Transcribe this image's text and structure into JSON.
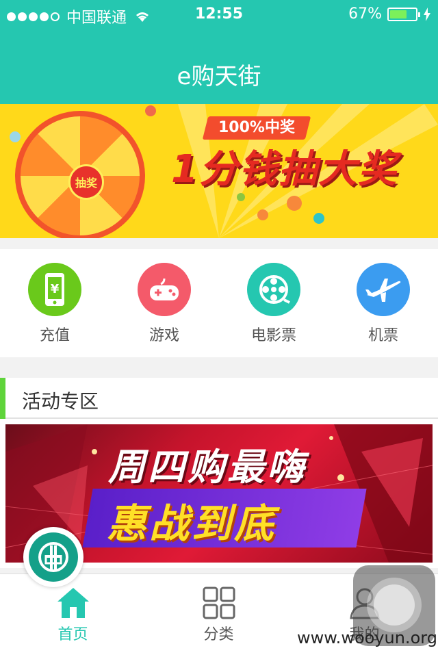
{
  "status_bar": {
    "carrier": "中国联通",
    "time": "12:55",
    "battery_percent": "67%",
    "battery_level": 0.67
  },
  "header": {
    "title": "e购天街"
  },
  "banner": {
    "wheel_center": "抽奖",
    "badge": "100%中奖",
    "headline": "1分钱抽大奖"
  },
  "quick_links": [
    {
      "label": "充值",
      "icon": "phone-recharge-icon",
      "color": "#6ac91b"
    },
    {
      "label": "游戏",
      "icon": "gamepad-icon",
      "color": "#f45a6a"
    },
    {
      "label": "电影票",
      "icon": "film-reel-icon",
      "color": "#25c7b0"
    },
    {
      "label": "机票",
      "icon": "airplane-icon",
      "color": "#3b9cf0"
    }
  ],
  "section": {
    "title": "活动专区"
  },
  "promo": {
    "line1": "周四购最嗨",
    "line2": "惠战到底"
  },
  "tabs": [
    {
      "label": "首页",
      "active": true
    },
    {
      "label": "分类",
      "active": false
    },
    {
      "label": "我的",
      "active": false
    }
  ],
  "watermark": "www.wooyun.org",
  "colors": {
    "accent": "#25c7b0",
    "banner_yellow": "#ffd91a",
    "section_bar": "#5fd43b"
  }
}
